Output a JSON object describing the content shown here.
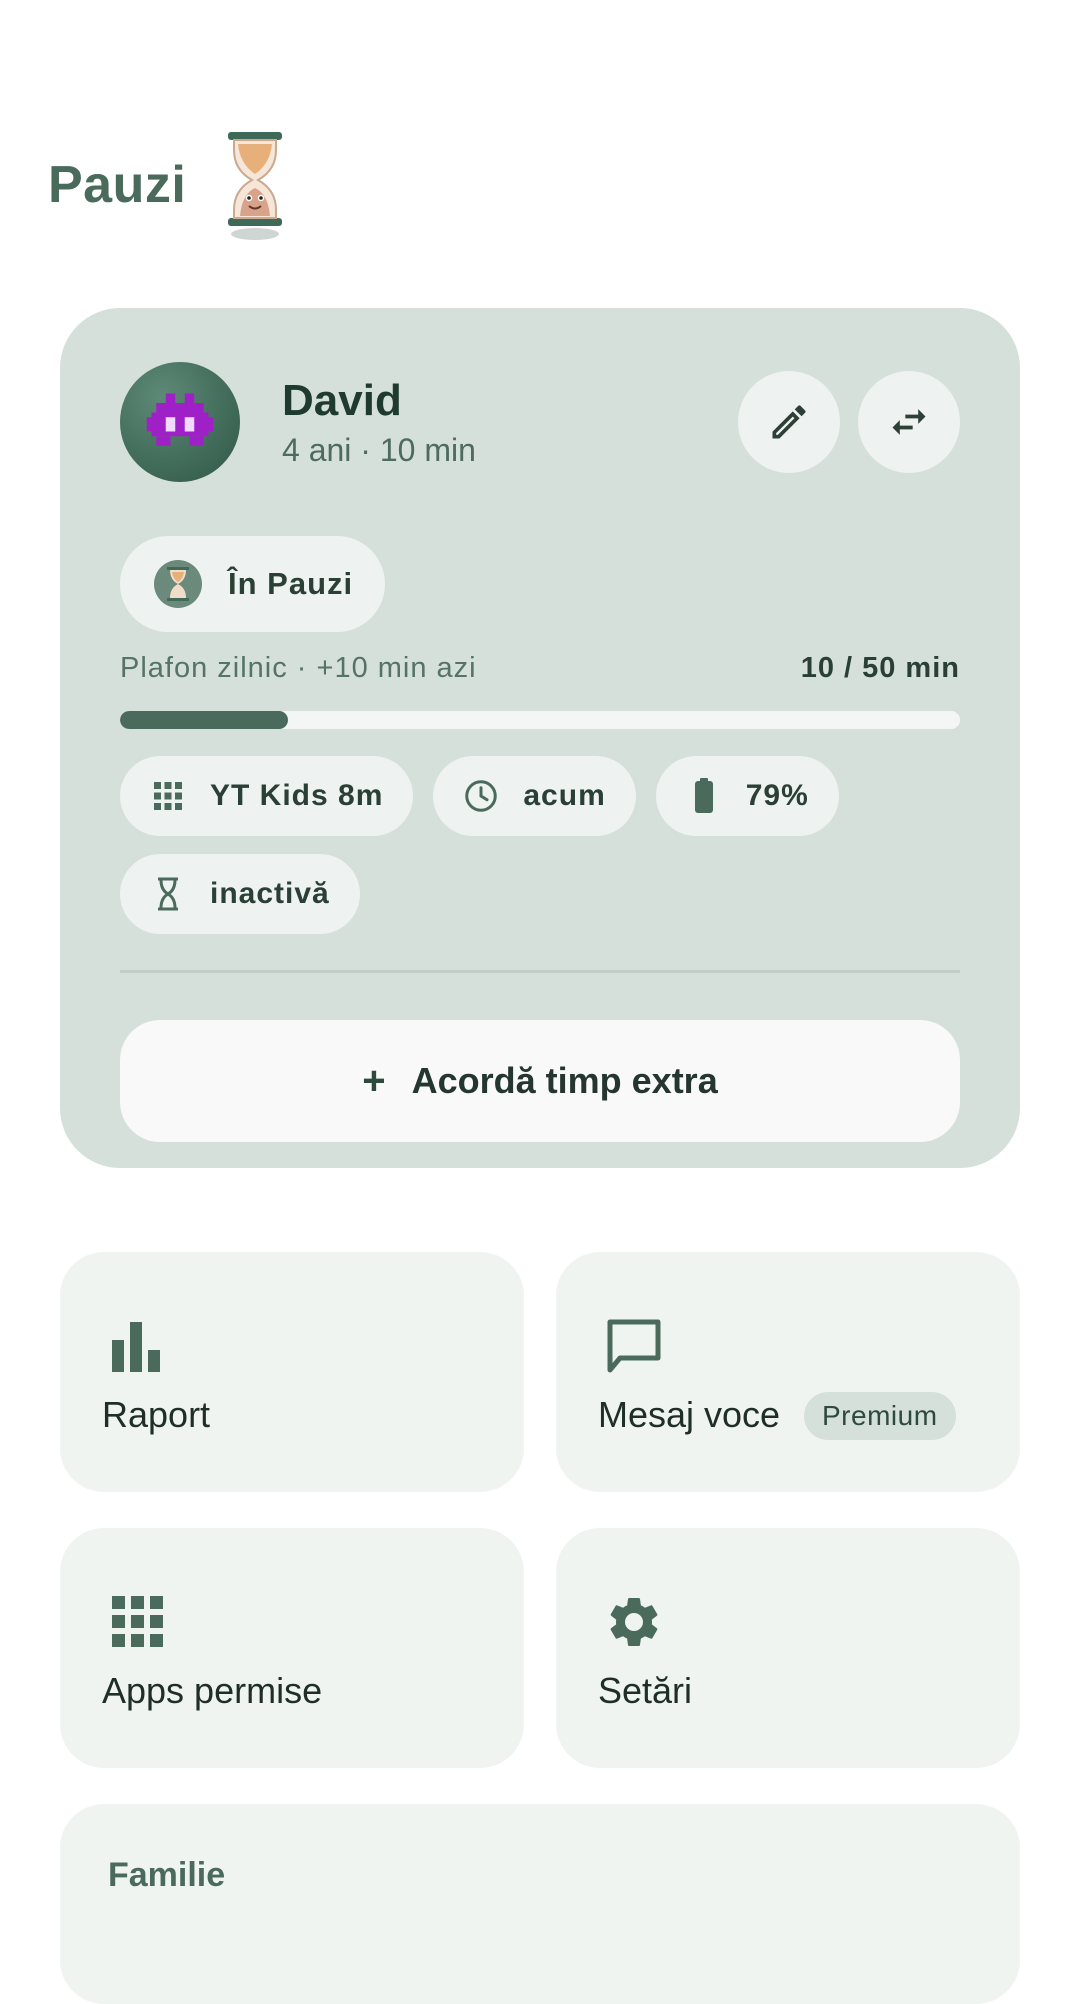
{
  "app": {
    "title": "Pauzi"
  },
  "child": {
    "name": "David",
    "meta": "4 ani · 10 min",
    "status": "În Pauzi",
    "limit_label": "Plafon zilnic · +10 min azi",
    "limit_value": "10 / 50 min",
    "used_fraction": 0.2,
    "chips": [
      {
        "icon": "apps-grid-icon",
        "label": "YT Kids 8m"
      },
      {
        "icon": "clock-icon",
        "label": "acum"
      },
      {
        "icon": "battery-icon",
        "label": "79%"
      },
      {
        "icon": "hourglass-icon",
        "label": "inactivă"
      }
    ],
    "extra_button": {
      "icon": "plus-icon",
      "label": "Acordă timp extra"
    }
  },
  "tiles": {
    "report": {
      "icon": "bar-chart-icon",
      "label": "Raport"
    },
    "voice": {
      "icon": "message-icon",
      "label": "Mesaj voce",
      "badge": "Premium"
    },
    "apps": {
      "icon": "apps-grid-icon",
      "label": "Apps permise"
    },
    "settings": {
      "icon": "gear-icon",
      "label": "Setări"
    }
  },
  "family": {
    "title": "Familie"
  },
  "colors": {
    "primary": "#4a6b5c",
    "card": "#d6e0db",
    "tile": "#f0f4f1"
  }
}
